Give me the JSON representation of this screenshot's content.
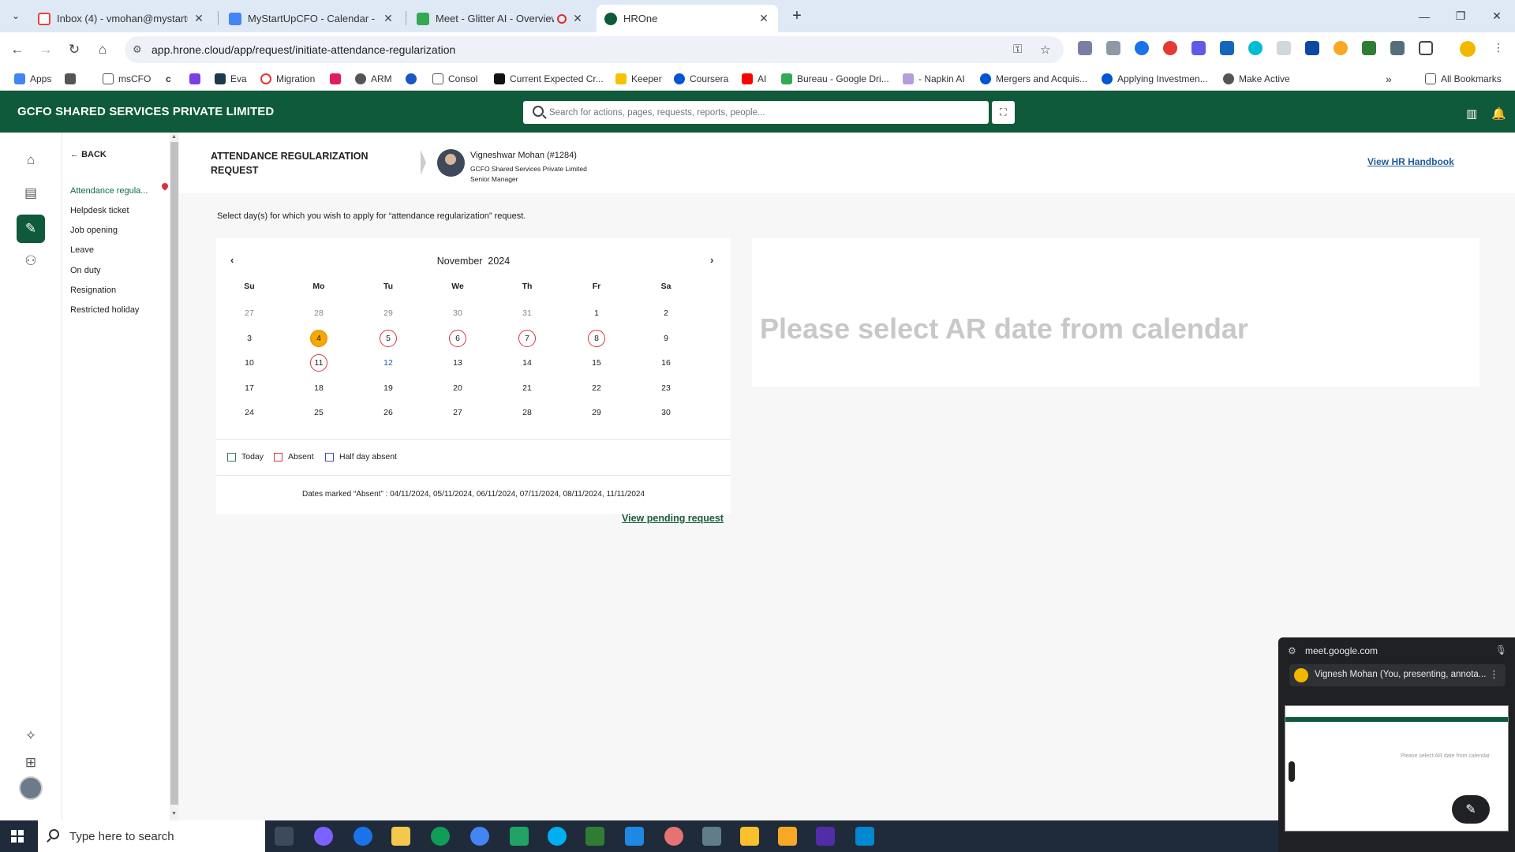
{
  "browser": {
    "tabs": [
      {
        "title": "Inbox (4) - vmohan@mystartupcfo",
        "color": "#ea4335"
      },
      {
        "title": "MyStartUpCFO - Calendar - Week",
        "color": "#4285f4"
      },
      {
        "title": "Meet - Glitter AI - Overview",
        "color": "#34a853"
      },
      {
        "title": "HROne",
        "color": "#0e5a3a"
      }
    ],
    "url": "app.hrone.cloud/app/request/initiate-attendance-regularization",
    "bookmarks": [
      "Apps",
      "msCFO",
      "Eva",
      "Migration",
      "ARM",
      "Consol",
      "Current Expected Cr...",
      "Keeper",
      "Coursera",
      "AI",
      "Bureau - Google Dri...",
      "- Napkin AI",
      "Mergers and Acquis...",
      "Applying Investmen...",
      "Make Active"
    ],
    "all_bookmarks": "All Bookmarks"
  },
  "header": {
    "company": "GCFO SHARED SERVICES PRIVATE LIMITED",
    "search_placeholder": "Search for actions, pages, requests, reports, people..."
  },
  "submenu": {
    "back": "BACK",
    "items": [
      "Attendance regula...",
      "Helpdesk ticket",
      "Job opening",
      "Leave",
      "On duty",
      "Resignation",
      "Restricted holiday"
    ]
  },
  "page": {
    "title": "ATTENDANCE REGULARIZATION REQUEST",
    "employee": {
      "name": "Vigneshwar Mohan (#1284)",
      "company": "GCFO Shared Services Private Limited",
      "role": "Senior Manager"
    },
    "handbook": "View HR Handbook",
    "instruction": "Select day(s) for which you wish to apply for “attendance regularization” request.",
    "placeholder": "Please select AR date from calendar",
    "pending": "View pending request"
  },
  "calendar": {
    "month": "November",
    "year": "2024",
    "weekdays": [
      "Su",
      "Mo",
      "Tu",
      "We",
      "Th",
      "Fr",
      "Sa"
    ],
    "weeks": [
      [
        "27",
        "28",
        "29",
        "30",
        "31",
        "1",
        "2"
      ],
      [
        "3",
        "4",
        "5",
        "6",
        "7",
        "8",
        "9"
      ],
      [
        "10",
        "11",
        "12",
        "13",
        "14",
        "15",
        "16"
      ],
      [
        "17",
        "18",
        "19",
        "20",
        "21",
        "22",
        "23"
      ],
      [
        "24",
        "25",
        "26",
        "27",
        "28",
        "29",
        "30"
      ]
    ],
    "other_month_days": [
      "27",
      "28",
      "29",
      "30",
      "31"
    ],
    "today": "4",
    "absent": [
      "5",
      "6",
      "7",
      "8",
      "11"
    ],
    "highlight": [
      "12"
    ],
    "legend": [
      {
        "label": "Today",
        "color": "#2e7d5b"
      },
      {
        "label": "Absent",
        "color": "#d9303f"
      },
      {
        "label": "Half day absent",
        "color": "#3b4fc4"
      }
    ],
    "absent_dates_text": "Dates marked “Absent” : 04/11/2024, 05/11/2024, 06/11/2024, 07/11/2024, 08/11/2024, 11/11/2024"
  },
  "meet": {
    "domain": "meet.google.com",
    "presenter": "Vignesh Mohan (You, presenting, annota..."
  },
  "taskbar": {
    "search_placeholder": "Type here to search"
  }
}
